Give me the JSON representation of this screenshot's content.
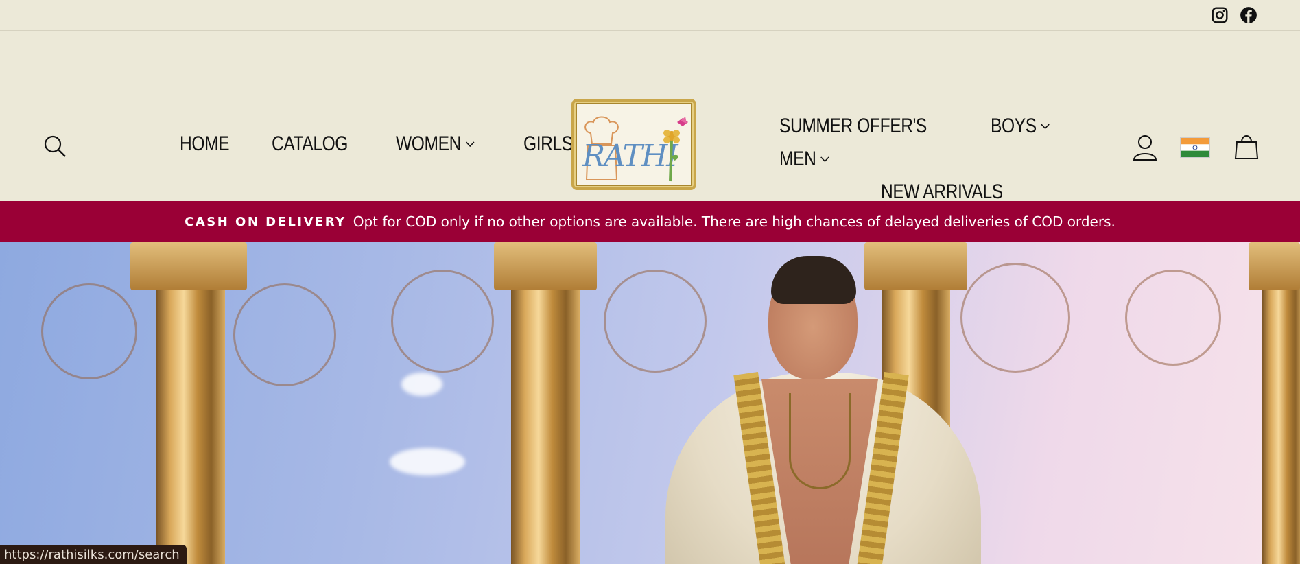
{
  "topbar": {
    "social": [
      {
        "name": "instagram-icon"
      },
      {
        "name": "facebook-icon"
      }
    ]
  },
  "nav": {
    "left": [
      {
        "label": "HOME",
        "has_dropdown": false
      },
      {
        "label": "CATALOG",
        "has_dropdown": false
      },
      {
        "label": "WOMEN",
        "has_dropdown": true
      },
      {
        "label": "GIRLS",
        "has_dropdown": true
      }
    ],
    "right": [
      {
        "label": "SUMMER OFFER'S",
        "has_dropdown": false
      },
      {
        "label": "BOYS",
        "has_dropdown": true
      },
      {
        "label": "MEN",
        "has_dropdown": true
      },
      {
        "label": "NEW ARRIVALS",
        "has_dropdown": false
      }
    ]
  },
  "logo": {
    "text": "RATHI"
  },
  "announcement": {
    "strong": "CASH ON DELIVERY",
    "text": "Opt for COD only if no other options are available. There are high chances of delayed deliveries of COD orders."
  },
  "status_bar": {
    "url": "https://rathisilks.com/search"
  },
  "colors": {
    "background": "#ece9d8",
    "announcement_bg": "#9a0036",
    "logo_border": "#c9a64a"
  }
}
